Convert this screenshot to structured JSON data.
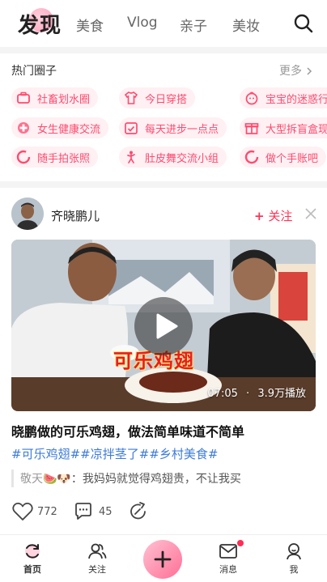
{
  "top_nav": {
    "tabs": [
      "发现",
      "美食",
      "Vlog",
      "亲子",
      "美妆"
    ],
    "active_tab": "发现",
    "search_icon": "search-icon"
  },
  "circles": {
    "title": "热门圈子",
    "more_label": "更多",
    "items": [
      {
        "label": "社畜划水圈",
        "icon": "briefcase-icon"
      },
      {
        "label": "今日穿搭",
        "icon": "tshirt-icon"
      },
      {
        "label": "宝宝的迷惑行",
        "icon": "baby-face-icon"
      },
      {
        "label": "女生健康交流",
        "icon": "health-icon"
      },
      {
        "label": "每天进步一点点",
        "icon": "calendar-check-icon"
      },
      {
        "label": "大型拆盲盒现",
        "icon": "gift-box-icon"
      },
      {
        "label": "随手拍张照",
        "icon": "camera-circle-icon"
      },
      {
        "label": "肚皮舞交流小组",
        "icon": "dance-icon"
      },
      {
        "label": "做个手账吧",
        "icon": "notebook-circle-icon"
      }
    ]
  },
  "post": {
    "author": "齐晓鹏儿",
    "follow_label": "关注",
    "video": {
      "caption": "可乐鸡翅",
      "duration": "07:05",
      "separator": "·",
      "views": "3.9万播放"
    },
    "title": "晓鹏做的可乐鸡翅，做法简单味道不简单",
    "tags": "#可乐鸡翅##凉拌茎了##乡村美食#",
    "comment": {
      "user": "敬天🍉🐶",
      "separator": "：",
      "text": "我妈妈就觉得鸡翅贵，不让我买"
    },
    "likes": "772",
    "comments": "45"
  },
  "bottom_nav": {
    "items": [
      {
        "label": "首页",
        "icon": "home-refresh-icon"
      },
      {
        "label": "关注",
        "icon": "users-icon"
      },
      {
        "label": "",
        "icon": "plus-icon"
      },
      {
        "label": "消息",
        "icon": "mail-icon"
      },
      {
        "label": "我",
        "icon": "profile-icon"
      }
    ]
  },
  "colors": {
    "accent": "#ff3355",
    "chip_bg": "#fff0f3",
    "chip_text": "#ff4a6e",
    "tag_blue": "#3d7bd9"
  }
}
